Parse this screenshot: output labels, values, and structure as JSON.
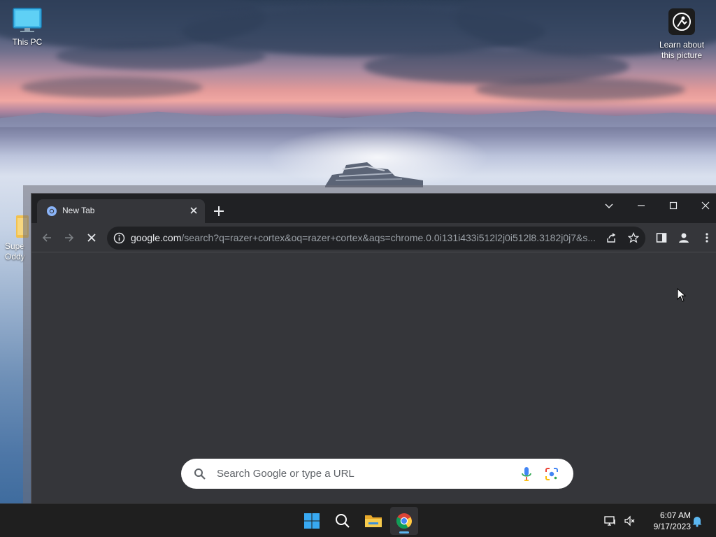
{
  "desktop": {
    "icons": [
      {
        "label": "This PC"
      },
      {
        "label": "Learn about this picture"
      },
      {
        "label": "Supe Oddy"
      }
    ]
  },
  "browser": {
    "tab": {
      "title": "New Tab"
    },
    "window_controls": [
      "tab-search",
      "minimize",
      "maximize",
      "close"
    ],
    "address_bar": {
      "host": "google.com",
      "path": "/search?q=razer+cortex&oq=razer+cortex&aqs=chrome.0.0i131i433i512l2j0i512l8.3182j0j7&s...",
      "loading": true
    },
    "search_box": {
      "placeholder": "Search Google or type a URL"
    }
  },
  "taskbar": {
    "apps": [
      "start",
      "search",
      "file-explorer",
      "chrome"
    ],
    "time": "6:07 AM",
    "date": "9/17/2023"
  },
  "colors": {
    "tabstrip": "#202124",
    "toolbar": "#35363a",
    "accent_indicator": "#5cb7f0"
  }
}
